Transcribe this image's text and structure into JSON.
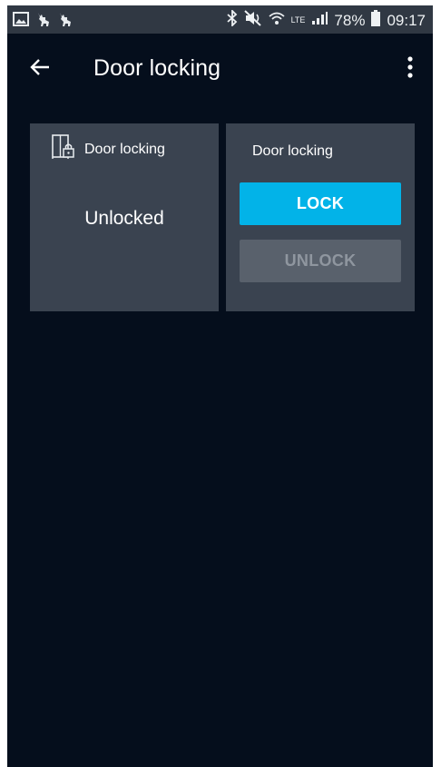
{
  "status_bar": {
    "battery": "78%",
    "time": "09:17",
    "network": "LTE",
    "left_icons": [
      "gallery-icon",
      "deer-icon",
      "deer-icon"
    ],
    "right_icons": [
      "bluetooth-icon",
      "mute-icon",
      "wifi-icon",
      "signal-icon",
      "battery-icon"
    ]
  },
  "app_bar": {
    "title": "Door locking",
    "back_icon": "arrow-left-icon",
    "menu_icon": "more-vert-icon"
  },
  "status_card": {
    "title": "Door locking",
    "icon": "door-lock-icon",
    "state": "Unlocked"
  },
  "control_card": {
    "title": "Door locking",
    "lock_label": "LOCK",
    "unlock_label": "UNLOCK",
    "unlock_enabled": false
  },
  "colors": {
    "background": "#050e1c",
    "status_bar": "#303843",
    "card": "#3a4350",
    "accent": "#02b3e8",
    "disabled_button": "#59616c"
  }
}
